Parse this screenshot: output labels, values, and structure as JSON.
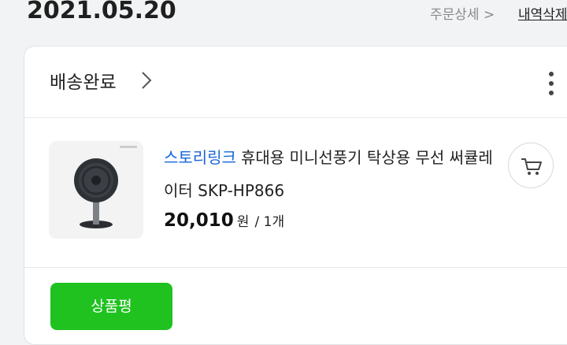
{
  "header": {
    "order_date": "2021.05.20",
    "order_detail_link": "주문상세 >",
    "history_delete_link": "내역삭제"
  },
  "order": {
    "status": "배송완료",
    "product": {
      "brand": "스토리링크",
      "name": "휴대용 미니선풍기 탁상용 무선 써큘레이터 SKP-HP866",
      "price": "20,010",
      "price_unit": "원",
      "quantity": "/ 1개",
      "image_icon": "desk-fan-image"
    },
    "review_button": "상품평"
  },
  "colors": {
    "brand_link": "#1565d8",
    "review_button_bg": "#1fc21f",
    "page_bg": "#f2f3f5"
  }
}
